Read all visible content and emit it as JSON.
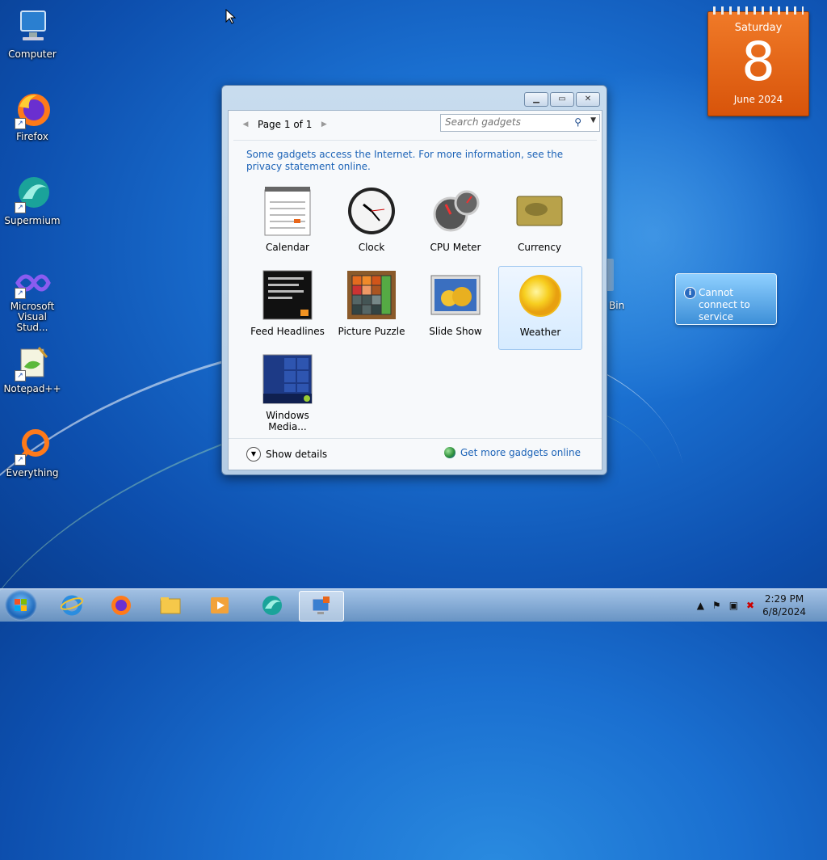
{
  "desktop": {
    "icons": [
      {
        "label": "Computer"
      },
      {
        "label": "Firefox"
      },
      {
        "label": "Supermium"
      },
      {
        "label": "Microsoft Visual Stud..."
      },
      {
        "label": "Notepad++"
      },
      {
        "label": "Everything"
      }
    ],
    "recycle_bin_label": "Bin"
  },
  "calendar_gadget": {
    "weekday": "Saturday",
    "day": "8",
    "month_year": "June 2024"
  },
  "weather_gadget": {
    "message": "Cannot connect to service"
  },
  "gallery": {
    "page_label": "Page 1 of 1",
    "search_placeholder": "Search gadgets",
    "notice": "Some gadgets access the Internet.  For more information, see the privacy statement online.",
    "gadgets": [
      {
        "label": "Calendar"
      },
      {
        "label": "Clock"
      },
      {
        "label": "CPU Meter"
      },
      {
        "label": "Currency"
      },
      {
        "label": "Feed Headlines"
      },
      {
        "label": "Picture Puzzle"
      },
      {
        "label": "Slide Show"
      },
      {
        "label": "Weather"
      },
      {
        "label": "Windows Media..."
      }
    ],
    "selected_gadget": "Weather",
    "show_details": "Show details",
    "get_more": "Get more gadgets online"
  },
  "taskbar": {
    "apps": [
      "internet-explorer-icon",
      "firefox-icon",
      "file-explorer-icon",
      "media-player-icon",
      "supermium-icon",
      "gadgets-icon"
    ],
    "time": "2:29 PM",
    "date": "6/8/2024"
  },
  "colors": {
    "accent_link": "#1c63b7",
    "calendar_orange": "#e8661a"
  }
}
